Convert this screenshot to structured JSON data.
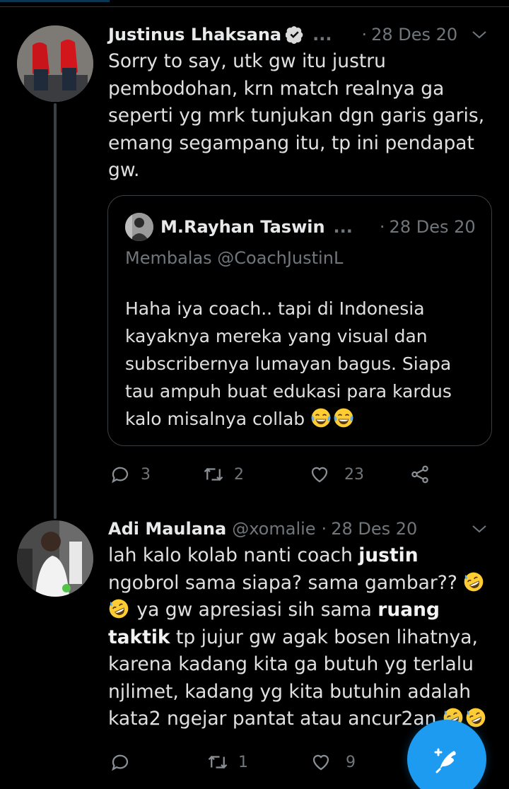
{
  "tweet1": {
    "name": "Justinus Lhaksana",
    "ellipsis": "...",
    "dot": "·",
    "date": "28 Des 20",
    "text": "Sorry to say, utk gw itu justru pembodohan, krn match realnya ga seperti yg mrk tunjukan dgn garis garis, emang segampang itu, tp ini pendapat gw.",
    "quote": {
      "name": "M.Rayhan Taswin",
      "ellipsis": "...",
      "dot": "·",
      "date": "28 Des 20",
      "reply": "Membalas @CoachJustinL",
      "text": "Haha iya coach.. tapi di Indonesia kayaknya mereka yang visual dan subscribernya lumayan bagus. Siapa tau ampuh buat edukasi para kardus kalo misalnya collab",
      "emoji": [
        "face-with-tears-of-joy",
        "face-with-tears-of-joy"
      ]
    },
    "actions": {
      "replies": "3",
      "retweets": "2",
      "likes": "23"
    }
  },
  "tweet2": {
    "name": "Adi Maulana",
    "handle": "@xomalie",
    "dot": "·",
    "date": "28 Des 20",
    "text_1": "lah kalo kolab nanti coach ",
    "bold_1": "justin",
    "text_2": " ngobrol sama siapa? sama gambar?? ",
    "emoji_1": [
      "rolling-on-the-floor-laughing",
      "rolling-on-the-floor-laughing"
    ],
    "text_3": " ya gw apresiasi sih sama ",
    "bold_2": "ruang taktik",
    "text_4": " tp jujur gw agak bosen lihatnya, karena kadang kita ga butuh yg terlalu njlimet, kadang yg kita butuhin adalah kata2 ngejar pantat atau ancur2an ",
    "emoji_2": [
      "rolling-on-the-floor-laughing",
      "rolling-on-the-floor-laughing"
    ],
    "actions": {
      "replies": "",
      "retweets": "1",
      "likes": "9"
    }
  },
  "colors": {
    "background": "#000000",
    "accent": "#1d9bf0",
    "muted": "#71767b",
    "text": "#e0e0e0"
  },
  "icons": [
    "verified-badge-icon",
    "chevron-down-icon",
    "reply-icon",
    "retweet-icon",
    "like-icon",
    "share-icon",
    "compose-tweet-icon"
  ]
}
